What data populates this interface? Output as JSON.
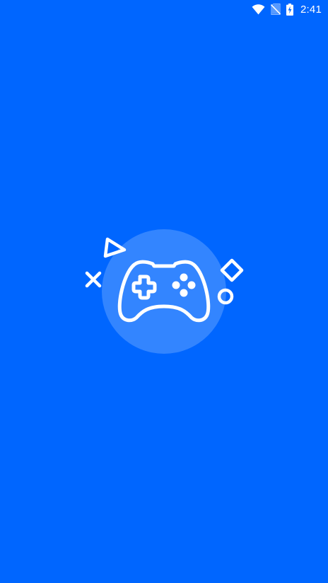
{
  "status_bar": {
    "time": "2:41",
    "icons": [
      "wifi-icon",
      "no-sim-icon",
      "battery-charging-icon"
    ],
    "color": "#ffffff"
  },
  "splash": {
    "background_color": "#0066ff",
    "circle_color": "#3385ff",
    "icons": [
      "gamepad-icon",
      "triangle-symbol-icon",
      "cross-symbol-icon",
      "diamond-symbol-icon",
      "circle-symbol-icon"
    ]
  }
}
